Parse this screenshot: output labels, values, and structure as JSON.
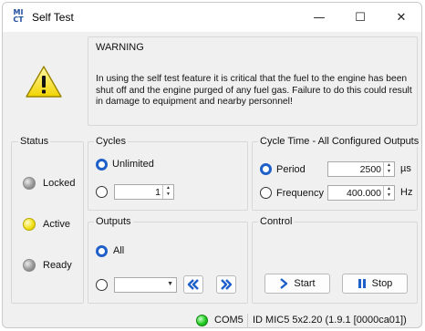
{
  "window": {
    "title": "Self Test",
    "icon_text_top": "MI",
    "icon_text_bottom": "CT",
    "minimize_glyph": "—",
    "maximize_glyph": "☐",
    "close_glyph": "✕"
  },
  "warning": {
    "title": "WARNING",
    "message": "In using the self test feature it is critical that the fuel to the engine has been shut off and the engine purged of any fuel gas. Failure to do this could result in damage to equipment and nearby personnel!"
  },
  "status": {
    "label": "Status",
    "items": [
      {
        "label": "Locked",
        "color": "gray"
      },
      {
        "label": "Active",
        "color": "yellow"
      },
      {
        "label": "Ready",
        "color": "gray"
      }
    ]
  },
  "cycles": {
    "label": "Cycles",
    "unlimited_label": "Unlimited",
    "unlimited_selected": true,
    "count_value": "1"
  },
  "cycle_time": {
    "label": "Cycle Time - All Configured Outputs",
    "period_label": "Period",
    "period_value": "2500",
    "period_unit": "µs",
    "period_selected": true,
    "frequency_label": "Frequency",
    "frequency_value": "400.000",
    "frequency_unit": "Hz"
  },
  "outputs": {
    "label": "Outputs",
    "all_label": "All",
    "all_selected": true,
    "combo_value": ""
  },
  "control": {
    "label": "Control",
    "start_label": "Start",
    "stop_label": "Stop"
  },
  "statusbar": {
    "port": "COM5",
    "device": "ID MIC5 5x2.20 (1.9.1 [0000ca01])",
    "connection_color": "#22cc22"
  }
}
